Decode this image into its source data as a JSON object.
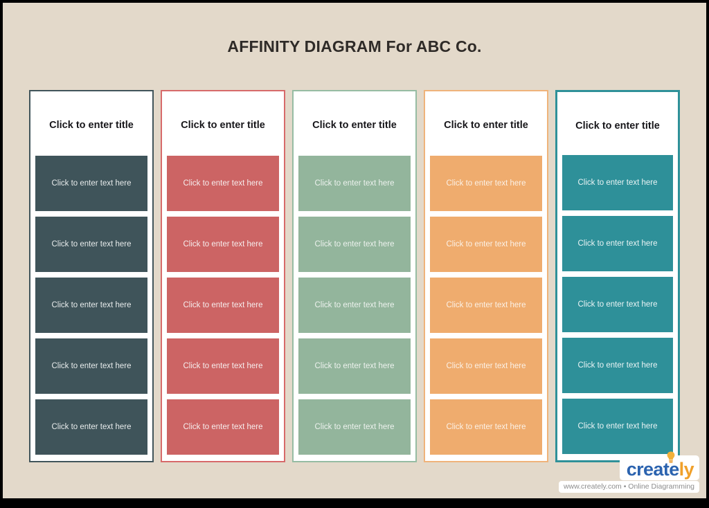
{
  "canvas": {
    "background": "#E3D9CA",
    "frame_color": "#000000"
  },
  "title": "AFFINITY DIAGRAM For ABC Co.",
  "columns": [
    {
      "id": "column-1",
      "title": "Click to enter title",
      "border_color": "#41555B",
      "card_color": "#3F545A",
      "card_text_color": "#E8ECEC",
      "cards": [
        "Click to enter text here",
        "Click to enter text here",
        "Click to enter text here",
        "Click to enter text here",
        "Click to enter text here"
      ]
    },
    {
      "id": "column-2",
      "title": "Click to enter title",
      "border_color": "#D76A6A",
      "card_color": "#CC6464",
      "card_text_color": "#F6EDED",
      "cards": [
        "Click to enter text here",
        "Click to enter text here",
        "Click to enter text here",
        "Click to enter text here",
        "Click to enter text here"
      ]
    },
    {
      "id": "column-3",
      "title": "Click to enter title",
      "border_color": "#96BCA3",
      "card_color": "#93B59C",
      "card_text_color": "#EDF2EE",
      "cards": [
        "Click to enter text here",
        "Click to enter text here",
        "Click to enter text here",
        "Click to enter text here",
        "Click to enter text here"
      ]
    },
    {
      "id": "column-4",
      "title": "Click to enter title",
      "border_color": "#EFB37A",
      "card_color": "#EFAC6E",
      "card_text_color": "#FBF1E6",
      "cards": [
        "Click to enter text here",
        "Click to enter text here",
        "Click to enter text here",
        "Click to enter text here",
        "Click to enter text here"
      ]
    },
    {
      "id": "column-5",
      "title": "Click to enter title",
      "border_color": "#2F9199",
      "card_color": "#2E9099",
      "card_text_color": "#EAF4F5",
      "cards": [
        "Click to enter text here",
        "Click to enter text here",
        "Click to enter text here",
        "Click to enter text here",
        "Click to enter text here"
      ]
    }
  ],
  "branding": {
    "name_part_1": "creat",
    "name_part_2": "e",
    "name_part_3": "ly",
    "tagline": "www.creately.com • Online Diagramming",
    "blue": "#2B63AF",
    "orange": "#F0A02A"
  }
}
